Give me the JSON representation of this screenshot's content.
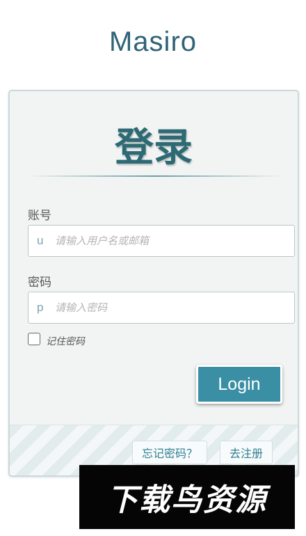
{
  "app": {
    "title": "Masiro"
  },
  "login": {
    "heading": "登录",
    "account": {
      "label": "账号",
      "prefix": "u",
      "placeholder": "请输入用户名或邮箱",
      "value": ""
    },
    "password": {
      "label": "密码",
      "prefix": "p",
      "placeholder": "请输入密码",
      "value": ""
    },
    "remember": {
      "label": "记住密码",
      "checked": false
    },
    "submit_label": "Login"
  },
  "footer": {
    "forgot_label": "忘记密码？",
    "register_label": "去注册"
  },
  "watermark": {
    "text": "下载鸟资源"
  },
  "colors": {
    "title": "#2f6379",
    "heading": "#2c6a74",
    "button": "#3a8fa5",
    "link": "#2f7f92"
  }
}
